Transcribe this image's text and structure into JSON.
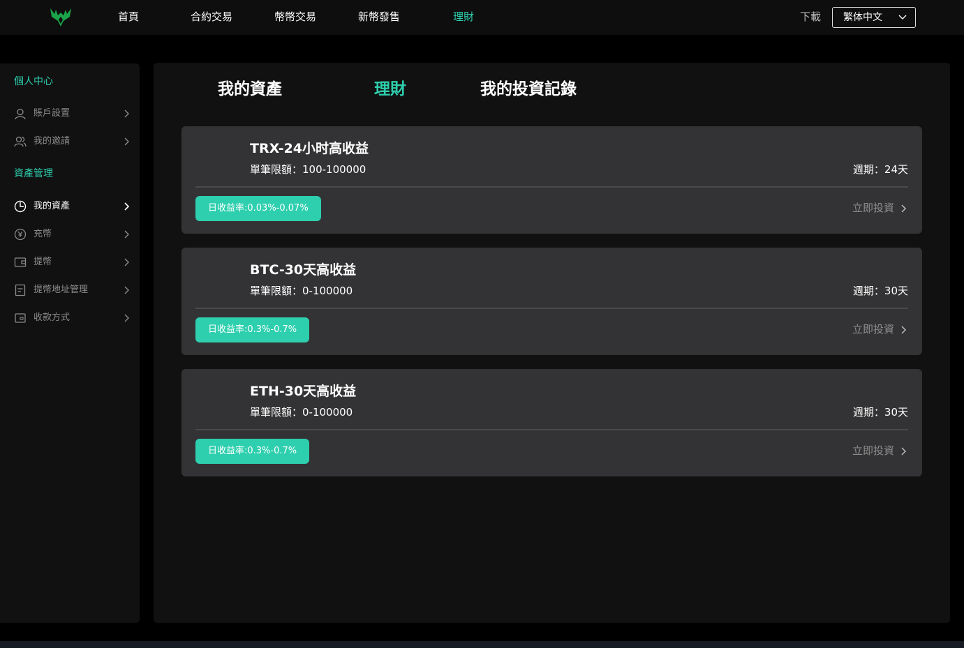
{
  "header": {
    "nav": [
      {
        "label": "首頁",
        "active": false
      },
      {
        "label": "合約交易",
        "active": false
      },
      {
        "label": "幣幣交易",
        "active": false
      },
      {
        "label": "新幣發售",
        "active": false
      },
      {
        "label": "理財",
        "active": true
      }
    ],
    "download_label": "下載",
    "language": "繁体中文"
  },
  "sidebar": {
    "section1": "個人中心",
    "items1": [
      {
        "label": "賬戶設置",
        "icon": "user-icon"
      },
      {
        "label": "我的邀請",
        "icon": "users-icon"
      }
    ],
    "section2": "資產管理",
    "items2": [
      {
        "label": "我的資產",
        "icon": "pie-chart-icon",
        "active": true
      },
      {
        "label": "充幣",
        "icon": "yen-coin-icon"
      },
      {
        "label": "提幣",
        "icon": "wallet-icon"
      },
      {
        "label": "提幣地址管理",
        "icon": "document-icon"
      },
      {
        "label": "收款方式",
        "icon": "card-icon"
      }
    ]
  },
  "tabs": [
    {
      "label": "我的資產",
      "active": false
    },
    {
      "label": "理財",
      "active": true
    },
    {
      "label": "我的投資記錄",
      "active": false
    }
  ],
  "products": [
    {
      "title": "TRX-24小时高收益",
      "limit": "單筆限額：100-100000",
      "cycle": "週期：24天",
      "rate": "日收益率:0.03%-0.07%",
      "action": "立即投資"
    },
    {
      "title": "BTC-30天高收益",
      "limit": "單筆限額：0-100000",
      "cycle": "週期：30天",
      "rate": "日收益率:0.3%-0.7%",
      "action": "立即投資"
    },
    {
      "title": "ETH-30天高收益",
      "limit": "單筆限額：0-100000",
      "cycle": "週期：30天",
      "rate": "日收益率:0.3%-0.7%",
      "action": "立即投資"
    }
  ],
  "colors": {
    "accent": "#2ecfae",
    "card": "#333335",
    "panel": "#111111"
  }
}
